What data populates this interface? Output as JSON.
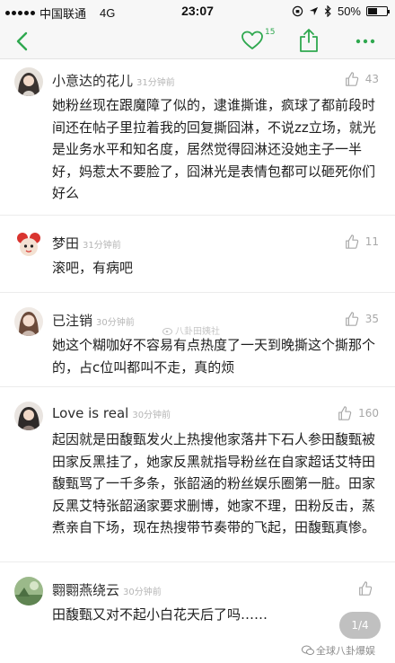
{
  "status_bar": {
    "carrier": "中国联通",
    "network": "4G",
    "time": "23:07",
    "battery": "50%",
    "battery_level": 0.5
  },
  "nav": {
    "like_count": "15"
  },
  "comments": [
    {
      "name": "小意达的花儿",
      "time": "31分钟前",
      "likes": "43",
      "text": "她粉丝现在跟魔障了似的，逮谁撕谁，疯球了都前段时间还在帖子里拉着我的回复撕囧淋，不说zz立场，就光是业务水平和知名度，居然觉得囧淋还没她主子一半好，妈惹太不要脸了，囧淋光是表情包都可以砸死你们好么"
    },
    {
      "name": "梦田",
      "time": "31分钟前",
      "likes": "11",
      "text": "滚吧，有病吧"
    },
    {
      "name": "已注销",
      "time": "30分钟前",
      "likes": "35",
      "text": "她这个糊咖好不容易有点热度了一天到晚撕这个撕那个的，占c位叫都叫不走，真的烦"
    },
    {
      "name": "Love is real",
      "time": "30分钟前",
      "likes": "160",
      "text": "起因就是田馥甄发火上热搜他家落井下石人参田馥甄被田家反黑挂了，她家反黑就指导粉丝在自家超话艾特田馥甄骂了一千多条，张韶涵的粉丝娱乐圈第一脏。田家反黑艾特张韶涵家要求删博，她家不理，田粉反击，蒸煮亲自下场，现在热搜带节奏带的飞起，田馥甄真惨。"
    },
    {
      "name": "翾翾燕绕云",
      "time": "30分钟前",
      "likes": "",
      "text": "田馥甄又对不起小白花天后了吗……"
    }
  ],
  "overlay": {
    "watermark_mid": "八卦田姨社",
    "page_indicator": "1/4",
    "watermark_bottom": "全球八卦爆娱"
  },
  "colors": {
    "accent": "#2fa84f",
    "text": "#1e1e1e",
    "meta": "#b5b5b5"
  }
}
